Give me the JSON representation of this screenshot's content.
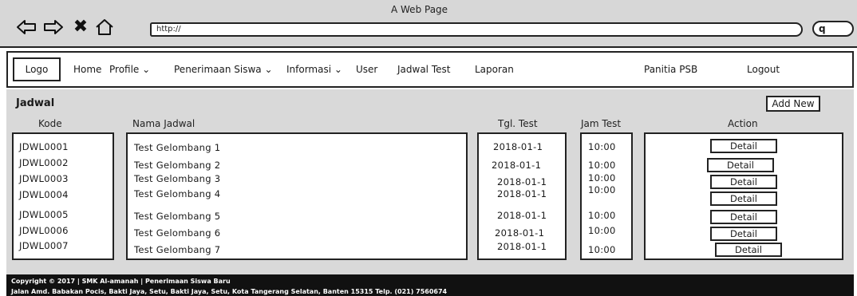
{
  "window": {
    "title": "A Web Page"
  },
  "browser": {
    "url": "http://",
    "icons": [
      "back-arrow-icon",
      "forward-arrow-icon",
      "close-x-icon",
      "home-icon",
      "search-icon"
    ]
  },
  "menu": {
    "logo": "Logo",
    "items": [
      "Home",
      "Profile ⌄",
      "Penerimaan Siswa ⌄",
      "Informasi ⌄",
      "User",
      "Jadwal Test",
      "Laporan",
      "Panitia PSB",
      "Logout"
    ]
  },
  "page": {
    "title": "Jadwal",
    "add_new": "Add New"
  },
  "table": {
    "headers": [
      "Kode",
      "Nama Jadwal",
      "Tgl. Test",
      "Jam Test",
      "Action"
    ],
    "rows": [
      [
        "JDWL0001",
        "Test Gelombang 1",
        "2018-01-1",
        "10:00",
        "Detail"
      ],
      [
        "JDWL0002",
        "Test Gelombang 2",
        "2018-01-1",
        "10:00",
        "Detail"
      ],
      [
        "JDWL0003",
        "Test Gelombang 3",
        "2018-01-1",
        "10:00",
        "Detail"
      ],
      [
        "JDWL0004",
        "Test Gelombang 4",
        "2018-01-1",
        "10:00",
        "Detail"
      ],
      [
        "JDWL0005",
        "Test Gelombang 5",
        "2018-01-1",
        "10:00",
        "Detail"
      ],
      [
        "JDWL0006",
        "Test Gelombang 6",
        "2018-01-1",
        "10:00",
        "Detail"
      ],
      [
        "JDWL0007",
        "Test Gelombang 7",
        "2018-01-1",
        "10:00",
        "Detail"
      ]
    ]
  },
  "footer": {
    "line1": "Copyright © 2017 | SMK Al-amanah | Penerimaan Siswa Baru",
    "line2": "Jalan Amd. Babakan Pocis, Bakti Jaya, Setu, Bakti Jaya, Setu, Kota Tangerang Selatan, Banten 15315 Telp. (021) 7560674"
  }
}
